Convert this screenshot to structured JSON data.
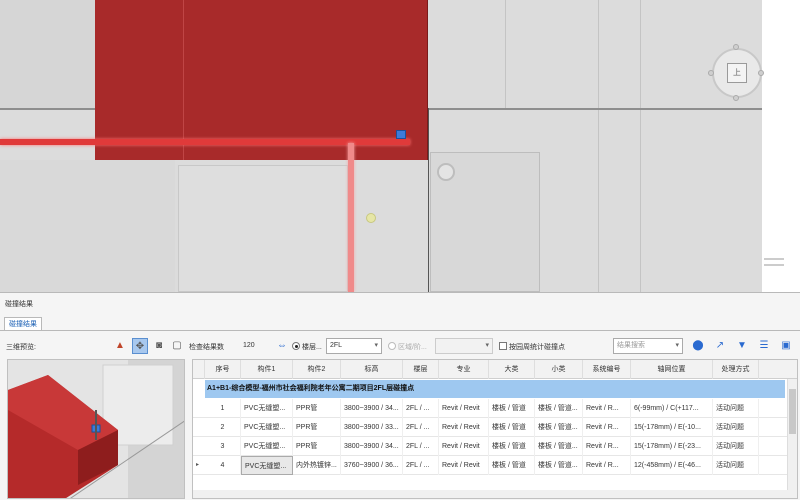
{
  "viewport": {
    "viewcube_label": "上"
  },
  "panel": {
    "title": "碰撞结果",
    "tab_label": "碰撞结果"
  },
  "toolbar": {
    "preview_label": "三维预览:",
    "count_label": "检查结果数",
    "count_value": "120",
    "radio_floor_label": "楼层...",
    "floor_select_value": "2FL",
    "radio_region_label": "区域/阶...",
    "checkbox_label": "按园周统计碰撞点",
    "search_placeholder": "结果搜索"
  },
  "table": {
    "columns": [
      "序号",
      "构件1",
      "构件2",
      "标高",
      "楼层",
      "专业",
      "大类",
      "小类",
      "系统编号",
      "轴网位置",
      "处理方式"
    ],
    "group_title": "A1+B1-综合模型-福州市社会福利院老年公寓二期项目2FL层碰撞点",
    "rows": [
      [
        "1",
        "PVC无缝塑...",
        "PPR管",
        "3800~3900 / 34...",
        "2FL / ...",
        "Revit / Revit",
        "楼板 / 管道",
        "楼板 / 管道...",
        "Revit / R...",
        "6(-99mm) / C(+117...",
        "活动问题"
      ],
      [
        "2",
        "PVC无缝塑...",
        "PPR管",
        "3800~3900 / 33...",
        "2FL / ...",
        "Revit / Revit",
        "楼板 / 管道",
        "楼板 / 管道...",
        "Revit / R...",
        "15(-178mm) / E(-10...",
        "活动问题"
      ],
      [
        "3",
        "PVC无缝塑...",
        "PPR管",
        "3800~3900 / 34...",
        "2FL / ...",
        "Revit / Revit",
        "楼板 / 管道",
        "楼板 / 管道...",
        "Revit / R...",
        "15(-178mm) / E(-23...",
        "活动问题"
      ],
      [
        "4",
        "PVC无缝塑...",
        "内外热镀锌...",
        "3760~3900 / 36...",
        "2FL / ...",
        "Revit / Revit",
        "楼板 / 管道",
        "楼板 / 管道...",
        "Revit / R...",
        "12(-458mm) / E(-46...",
        "活动问题"
      ]
    ]
  },
  "colors": {
    "clash_red": "#a82a2a",
    "pipe_red": "#e03a3a",
    "group_blue": "#9ec8f0",
    "marker_blue": "#3c7bd9"
  }
}
